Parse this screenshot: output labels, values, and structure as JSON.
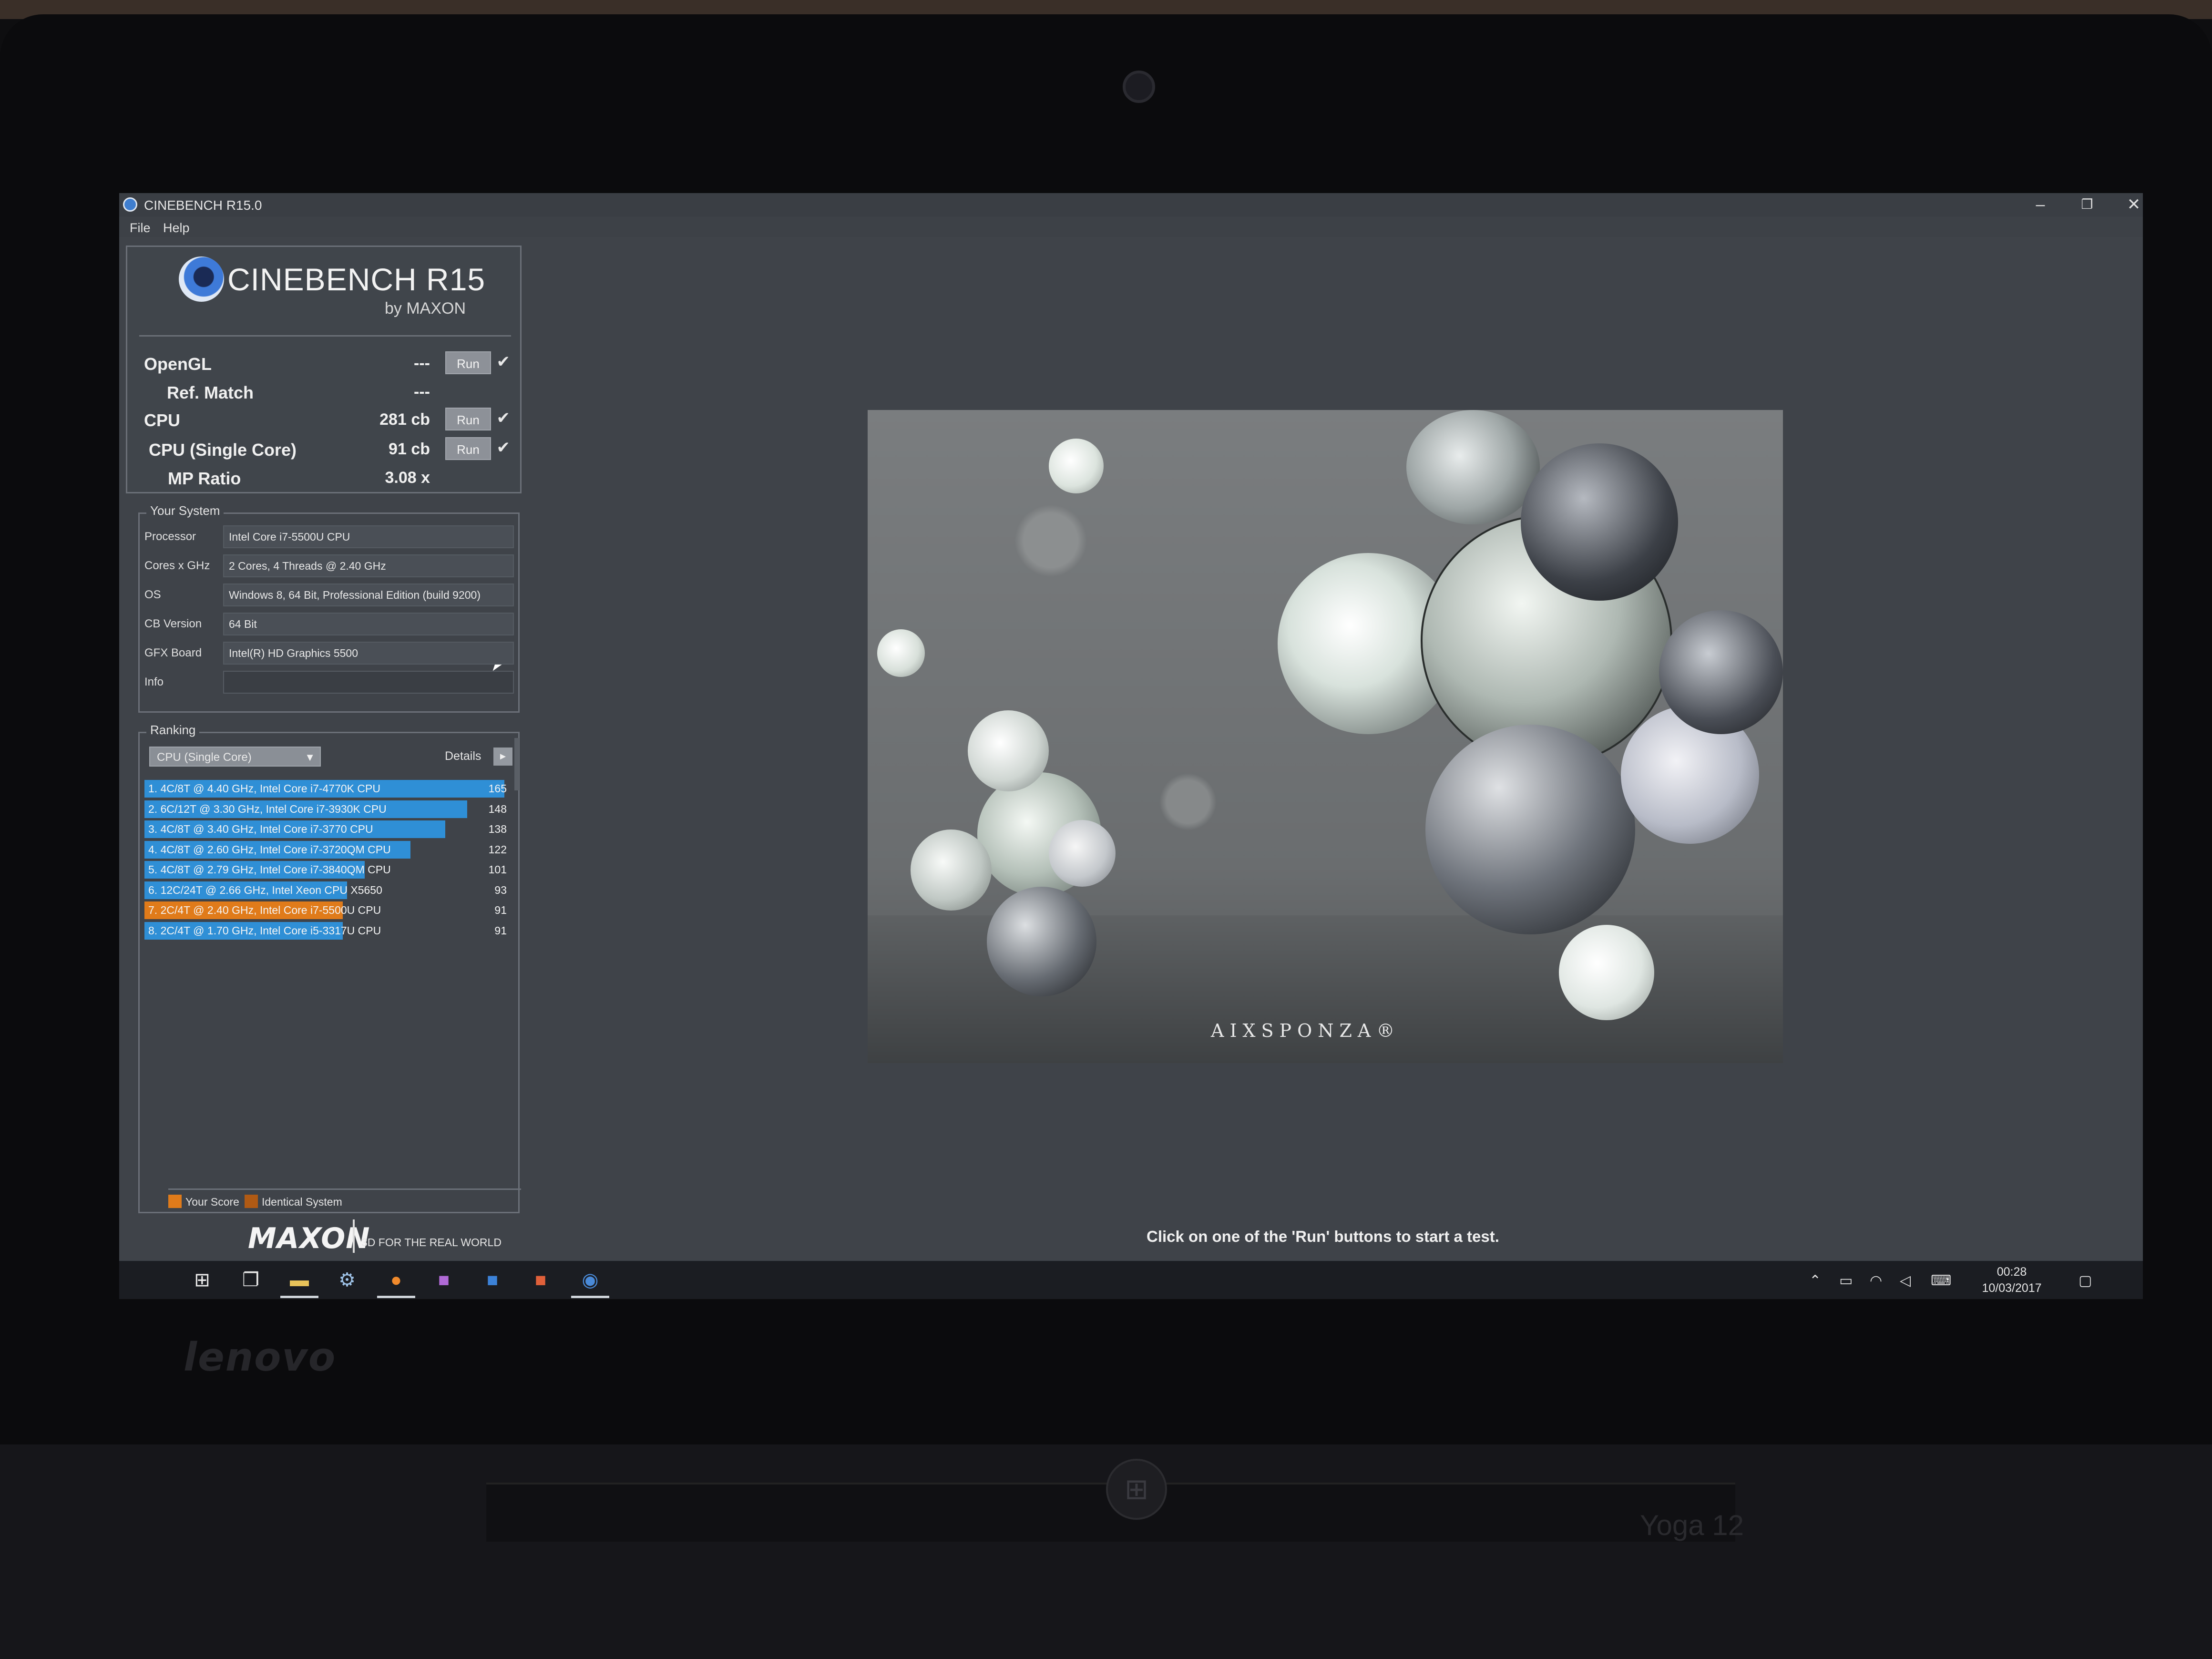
{
  "window": {
    "title": "CINEBENCH R15.0",
    "controls": {
      "minimize": "–",
      "restore": "❐",
      "close": "✕"
    }
  },
  "menu": [
    "File",
    "Help"
  ],
  "logo": {
    "title": "CINEBENCH R15",
    "subtitle": "by MAXON"
  },
  "benchmarks": [
    {
      "label": "OpenGL",
      "value": "---",
      "run_label": "Run",
      "has_run": true,
      "checked": true
    },
    {
      "label": "Ref. Match",
      "value": "---",
      "has_run": false
    },
    {
      "label": "CPU",
      "value": "281 cb",
      "run_label": "Run",
      "has_run": true,
      "checked": true
    },
    {
      "label": "CPU (Single Core)",
      "value": "91 cb",
      "run_label": "Run",
      "has_run": true,
      "checked": true
    },
    {
      "label": "MP Ratio",
      "value": "3.08 x",
      "has_run": false
    }
  ],
  "your_system": {
    "title": "Your System",
    "rows": [
      {
        "label": "Processor",
        "value": "Intel Core i7-5500U CPU"
      },
      {
        "label": "Cores x GHz",
        "value": "2 Cores, 4 Threads @ 2.40 GHz"
      },
      {
        "label": "OS",
        "value": "Windows 8, 64 Bit, Professional Edition (build 9200)"
      },
      {
        "label": "CB Version",
        "value": "64 Bit"
      },
      {
        "label": "GFX Board",
        "value": "Intel(R) HD Graphics 5500"
      },
      {
        "label": "Info",
        "value": ""
      }
    ]
  },
  "ranking": {
    "title": "Ranking",
    "selected": "CPU (Single Core)",
    "details_label": "Details",
    "max_score": 165,
    "entries": [
      {
        "label": "1. 4C/8T @ 4.40 GHz, Intel Core i7-4770K CPU",
        "score": 165,
        "you": false
      },
      {
        "label": "2. 6C/12T @ 3.30 GHz,  Intel Core i7-3930K CPU",
        "score": 148,
        "you": false
      },
      {
        "label": "3. 4C/8T @ 3.40 GHz,  Intel Core i7-3770 CPU",
        "score": 138,
        "you": false
      },
      {
        "label": "4. 4C/8T @ 2.60 GHz, Intel Core i7-3720QM CPU",
        "score": 122,
        "you": false
      },
      {
        "label": "5. 4C/8T @ 2.79 GHz,  Intel Core i7-3840QM CPU",
        "score": 101,
        "you": false
      },
      {
        "label": "6. 12C/24T @ 2.66 GHz, Intel Xeon CPU X5650",
        "score": 93,
        "you": false
      },
      {
        "label": "7. 2C/4T @ 2.40 GHz, Intel Core i7-5500U CPU",
        "score": 91,
        "you": true
      },
      {
        "label": "8. 2C/4T @ 1.70 GHz,  Intel Core i5-3317U CPU",
        "score": 91,
        "you": false
      }
    ],
    "legend": {
      "your_score": "Your Score",
      "identical_system": "Identical System"
    }
  },
  "maxon": {
    "logo": "MAXON",
    "tagline": "3D FOR THE REAL WORLD"
  },
  "render": {
    "watermark": "AIXSPONZA®"
  },
  "status": "Click on one of the 'Run' buttons to start a test.",
  "taskbar": {
    "clock_time": "00:28",
    "clock_date": "10/03/2017"
  },
  "hardware": {
    "brand": "lenovo",
    "model": "Yoga 12"
  },
  "colors": {
    "bar_blue": "#2f8fd6",
    "bar_orange": "#e07b1a",
    "identical_swatch": "#b05a14"
  },
  "icons": {
    "start": "windows-start-icon",
    "task_view": "task-view-icon",
    "explorer": "file-explorer-icon",
    "steam": "steam-icon",
    "firefox": "firefox-icon",
    "onenote": "onenote-icon",
    "word": "word-icon",
    "powerpoint": "powerpoint-icon",
    "cinebench": "cinebench-icon"
  }
}
